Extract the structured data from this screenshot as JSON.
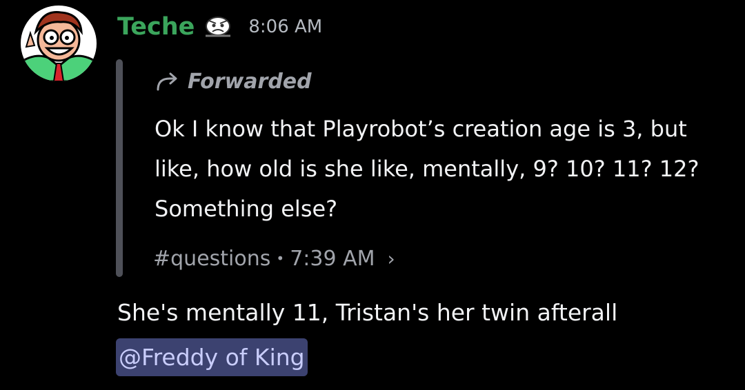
{
  "message": {
    "author": {
      "username": "Teche",
      "avatar_icon": "avatar-cartoon-glasses",
      "tag_icon": "custom-emoji-face-icon",
      "username_color": "#3ba55c"
    },
    "timestamp": "8:06 AM",
    "forward": {
      "label": "Forwarded",
      "icon": "forward-arrow-icon",
      "text": "Ok I know that Playrobot’s creation age is 3, but like, how old is she like, mentally, 9? 10? 11? 12? Something else?",
      "channel": "#questions",
      "separator": "•",
      "time": "7:39 AM",
      "chevron": "›"
    },
    "reply_text": "She's mentally 11, Tristan's her twin afterall",
    "mention": "@Freddy of King"
  },
  "colors": {
    "background": "#000000",
    "mention_bg": "#3c4270",
    "mention_text": "#c9cdfb",
    "muted_text": "#a1a4ab"
  }
}
